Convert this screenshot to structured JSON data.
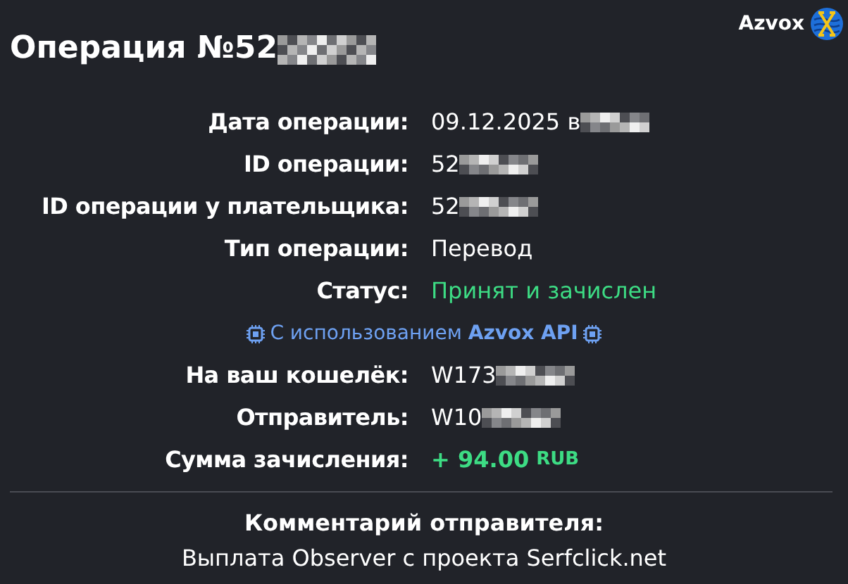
{
  "logo": {
    "text": "Azvox"
  },
  "title": {
    "text": "Операция №52",
    "redacted": true
  },
  "fields": [
    {
      "kind": "plain",
      "label": "Дата операции:",
      "value": "09.12.2025 в",
      "redacted": true
    },
    {
      "kind": "plain",
      "label": "ID операции:",
      "value": "52",
      "redacted": true
    },
    {
      "kind": "plain",
      "label": "ID операции у плательщика:",
      "value": "52",
      "redacted": true
    },
    {
      "kind": "plain",
      "label": "Тип операции:",
      "value": "Перевод",
      "redacted": false
    },
    {
      "kind": "status",
      "label": "Статус:",
      "value": "Принят и зачислен",
      "redacted": false
    },
    {
      "kind": "note",
      "text": "С использованием",
      "brand": "Azvox API"
    },
    {
      "kind": "plain",
      "label": "На ваш кошелёк:",
      "value": "W173",
      "redacted": true
    },
    {
      "kind": "plain",
      "label": "Отправитель:",
      "value": "W10",
      "redacted": true
    },
    {
      "kind": "amount",
      "label": "Сумма зачисления:",
      "value": "+ 94.00",
      "currency": "RUB",
      "redacted": false
    }
  ],
  "comment": {
    "title": "Комментарий отправителя:",
    "text": "Выплата Observer с проекта Serfclick.net"
  }
}
